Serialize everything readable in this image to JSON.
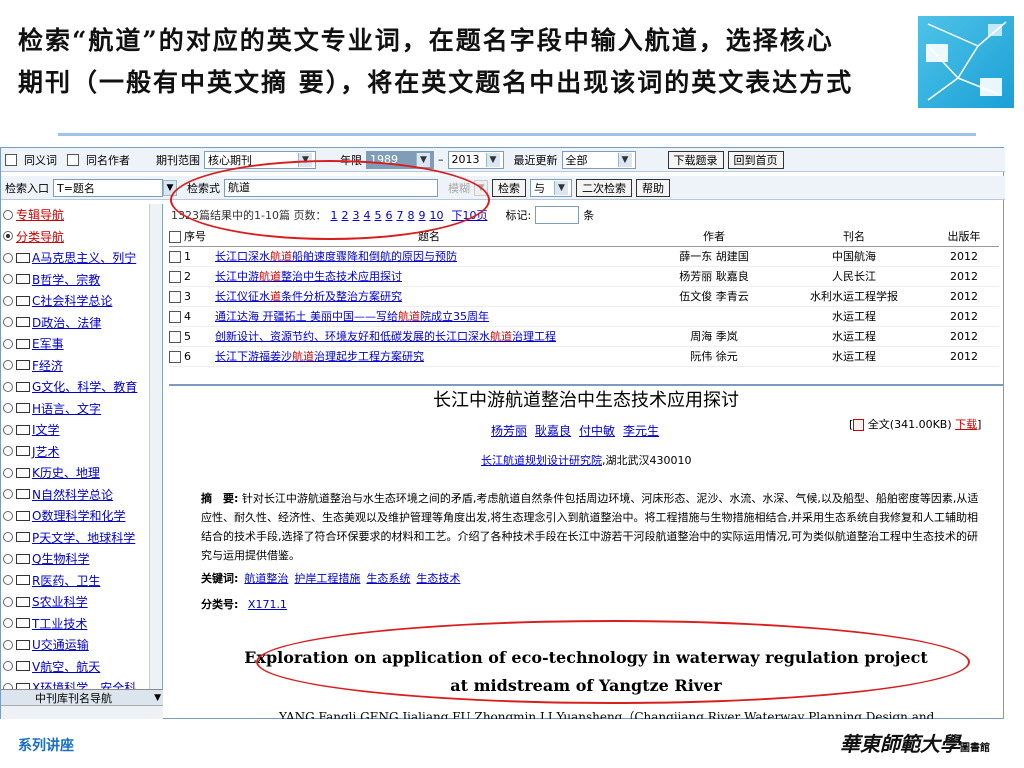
{
  "slide": {
    "title_line1": "检索“航道”的对应的英文专业词，在题名字段中输入航道，选择核心",
    "title_line2": "期刊（一般有中英文摘 要），将在英文题名中出现该词的英文表达方式",
    "footer_left": "系列讲座",
    "footer_right": "華東師範大學",
    "footer_right_small": "圖書館"
  },
  "toolbar1": {
    "synonym": "同义词",
    "same_author": "同名作者",
    "journal_range_label": "期刊范围",
    "journal_range": "核心期刊",
    "year_label": "年限",
    "year_from": "1989",
    "dash": "–",
    "year_to": "2013",
    "update_label": "最近更新",
    "update_value": "全部",
    "download_btn": "下载题录",
    "home_btn": "回到首页"
  },
  "toolbar2": {
    "entry_label": "检索入口",
    "entry_value": "T=题名",
    "query_label": "检索式",
    "query_value": "航道",
    "mode": "模糊",
    "search_btn": "检索",
    "logic": "与",
    "secondary_btn": "二次检索",
    "help_btn": "帮助"
  },
  "sidebar": {
    "items": [
      {
        "label": "专辑导航",
        "icon": "radio",
        "on": false
      },
      {
        "label": "分类导航",
        "icon": "radio",
        "on": true
      },
      {
        "label": "A马克思主义、列宁",
        "icon": "folder"
      },
      {
        "label": "B哲学、宗教",
        "icon": "folder"
      },
      {
        "label": "C社会科学总论",
        "icon": "folder"
      },
      {
        "label": "D政治、法律",
        "icon": "folder"
      },
      {
        "label": "E军事",
        "icon": "folder"
      },
      {
        "label": "F经济",
        "icon": "folder"
      },
      {
        "label": "G文化、科学、教育",
        "icon": "folder"
      },
      {
        "label": "H语言、文字",
        "icon": "folder"
      },
      {
        "label": "I文学",
        "icon": "folder"
      },
      {
        "label": "J艺术",
        "icon": "folder"
      },
      {
        "label": "K历史、地理",
        "icon": "folder"
      },
      {
        "label": "N自然科学总论",
        "icon": "folder"
      },
      {
        "label": "O数理科学和化学",
        "icon": "folder"
      },
      {
        "label": "P天文学、地球科学",
        "icon": "folder"
      },
      {
        "label": "Q生物科学",
        "icon": "folder"
      },
      {
        "label": "R医药、卫生",
        "icon": "folder"
      },
      {
        "label": "S农业科学",
        "icon": "folder"
      },
      {
        "label": "T工业技术",
        "icon": "folder"
      },
      {
        "label": "U交通运输",
        "icon": "folder"
      },
      {
        "label": "V航空、航天",
        "icon": "folder"
      },
      {
        "label": "X环境科学、安全科",
        "icon": "folder"
      }
    ],
    "footer": "中刊库刊名导航"
  },
  "results": {
    "summary": "1323篇结果中的1-10篇 页数：",
    "pages": [
      "1",
      "2",
      "3",
      "4",
      "5",
      "6",
      "7",
      "8",
      "9",
      "10"
    ],
    "next": "下10页",
    "mark_label": "标记:",
    "mark_unit": "条",
    "headers": {
      "no": "序号",
      "title": "题名",
      "author": "作者",
      "journal": "刊名",
      "year": "出版年"
    },
    "rows": [
      {
        "no": "1",
        "pre": "长江口深水",
        "hl": "航道",
        "post": "船舶速度骤降和倒航的原因与预防",
        "author": "薛一东 胡建国",
        "journal": "中国航海",
        "year": "2012"
      },
      {
        "no": "2",
        "pre": "长江中游",
        "hl": "航道",
        "post": "整治中生态技术应用探讨",
        "author": "杨芳丽 耿嘉良",
        "journal": "人民长江",
        "year": "2012"
      },
      {
        "no": "3",
        "pre": "长江仪征水",
        "hl": "道",
        "post": "条件分析及整治方案研究",
        "author": "伍文俊 李青云",
        "journal": "水利水运工程学报",
        "year": "2012"
      },
      {
        "no": "4",
        "pre": "通江达海 开疆拓土 美丽中国——写给",
        "hl": "航道",
        "post": "院成立35周年",
        "author": "",
        "journal": "水运工程",
        "year": "2012"
      },
      {
        "no": "5",
        "pre": "创新设计、资源节约、环境友好和低碳发展的长江口深水",
        "hl": "航道",
        "post": "治理工程",
        "author": "周海 季岚",
        "journal": "水运工程",
        "year": "2012"
      },
      {
        "no": "6",
        "pre": "长江下游福姜沙",
        "hl": "航道",
        "post": "治理起步工程方案研究",
        "author": "阮伟 徐元",
        "journal": "水运工程",
        "year": "2012"
      }
    ]
  },
  "detail": {
    "title": "长江中游航道整治中生态技术应用探讨",
    "authors": [
      "杨芳丽",
      "耿嘉良",
      "付中敏",
      "李元生"
    ],
    "fulltext": "全文(341.00KB)",
    "download": "下载",
    "affiliation_link": "长江航道规划设计研究院",
    "affiliation_rest": ",湖北武汉430010",
    "abstract_label": "摘　要:",
    "abstract": "针对长江中游航道整治与水生态环境之间的矛盾,考虑航道自然条件包括周边环境、河床形态、泥沙、水流、水深、气候,以及船型、船舶密度等因素,从适应性、耐久性、经济性、生态美观以及维护管理等角度出发,将生态理念引入到航道整治中。将工程措施与生物措施相结合,并采用生态系统自我修复和人工辅助相结合的技术手段,选择了符合环保要求的材料和工艺。介绍了各种技术手段在长江中游若干河段航道整治中的实际运用情况,可为类似航道整治工程中生态技术的研究与运用提供借鉴。",
    "keywords_label": "关键词:",
    "keywords": [
      "航道整治",
      "护岸工程措施",
      "生态系统",
      "生态技术"
    ],
    "class_label": "分类号:",
    "class_code": "X171.1",
    "en_title_line1": "Exploration on application of eco-technology in waterway regulation project",
    "en_title_line2": "at midstream of Yangtze River",
    "en_authors": "YANG Fangli,GENG Jialiang,FU Zhongmin,LI Yuansheng（Changjiang River Waterway Planning,Design and"
  },
  "colors": {
    "accent": "#1a6fc4",
    "highlight": "#d81e1e",
    "link": "#0000cc"
  }
}
